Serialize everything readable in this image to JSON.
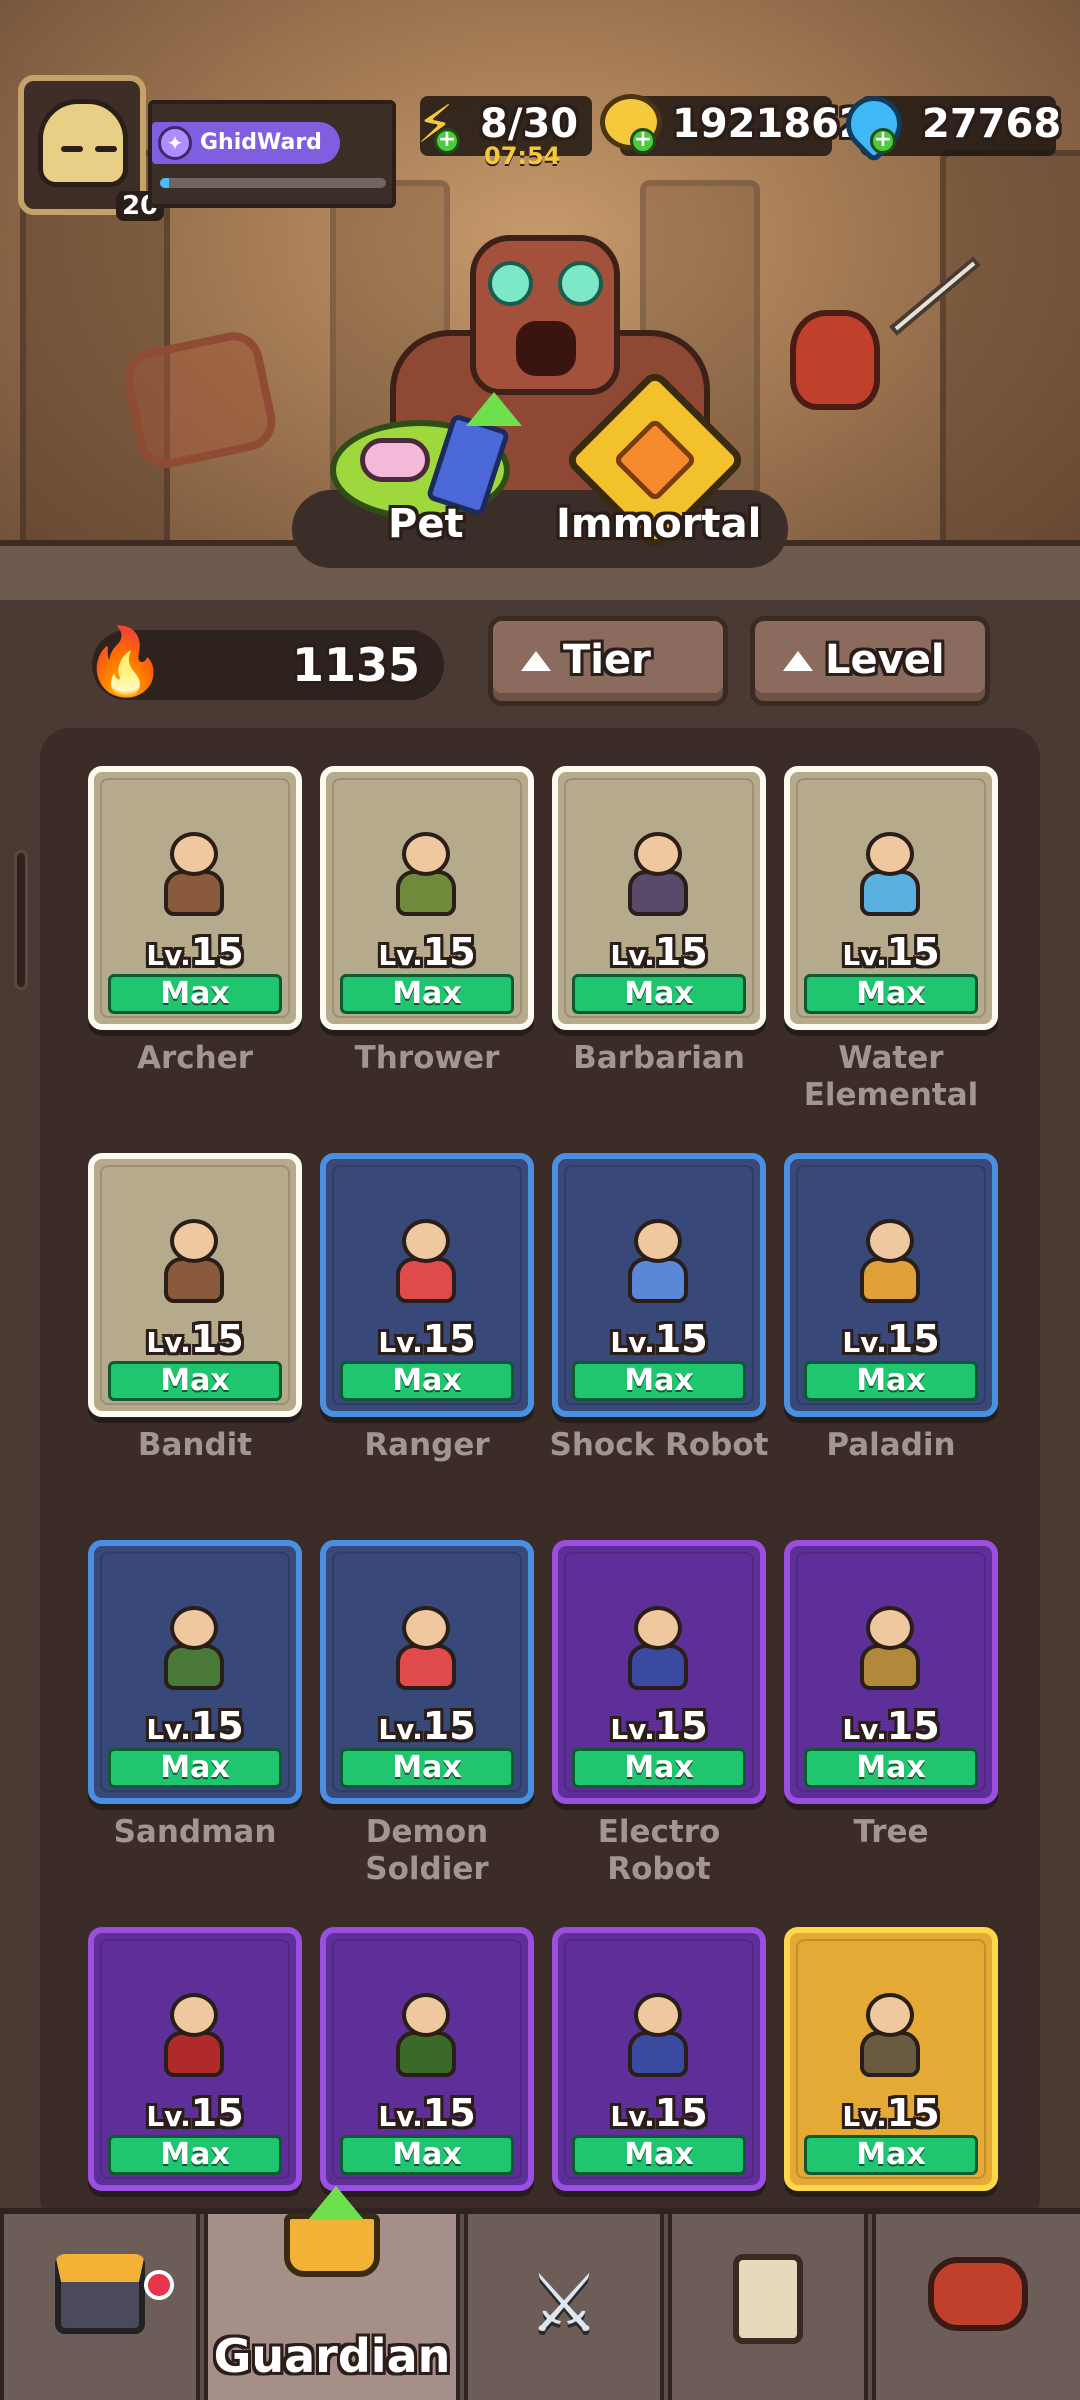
{
  "player": {
    "name": "GhidWard",
    "level": "20",
    "xp_progress": 0.04
  },
  "resources": {
    "energy": "8/30",
    "energy_timer": "07:54",
    "gold": "1921862",
    "gems": "27768"
  },
  "mode_switch": {
    "pet_label": "Pet",
    "immortal_label": "Immortal"
  },
  "filter_bar": {
    "power": "1135",
    "tier_label": "Tier",
    "level_label": "Level"
  },
  "cards": [
    {
      "name": "Archer",
      "lv_prefix": "Lv.",
      "lv": "15",
      "status": "Max",
      "rarity": "common"
    },
    {
      "name": "Thrower",
      "lv_prefix": "Lv.",
      "lv": "15",
      "status": "Max",
      "rarity": "common"
    },
    {
      "name": "Barbarian",
      "lv_prefix": "Lv.",
      "lv": "15",
      "status": "Max",
      "rarity": "common"
    },
    {
      "name": "Water Elemental",
      "lv_prefix": "Lv.",
      "lv": "15",
      "status": "Max",
      "rarity": "common"
    },
    {
      "name": "Bandit",
      "lv_prefix": "Lv.",
      "lv": "15",
      "status": "Max",
      "rarity": "common"
    },
    {
      "name": "Ranger",
      "lv_prefix": "Lv.",
      "lv": "15",
      "status": "Max",
      "rarity": "rare"
    },
    {
      "name": "Shock Robot",
      "lv_prefix": "Lv.",
      "lv": "15",
      "status": "Max",
      "rarity": "rare"
    },
    {
      "name": "Paladin",
      "lv_prefix": "Lv.",
      "lv": "15",
      "status": "Max",
      "rarity": "rare"
    },
    {
      "name": "Sandman",
      "lv_prefix": "Lv.",
      "lv": "15",
      "status": "Max",
      "rarity": "rare"
    },
    {
      "name": "Demon Soldier",
      "lv_prefix": "Lv.",
      "lv": "15",
      "status": "Max",
      "rarity": "rare"
    },
    {
      "name": "Electro Robot",
      "lv_prefix": "Lv.",
      "lv": "15",
      "status": "Max",
      "rarity": "epic"
    },
    {
      "name": "Tree",
      "lv_prefix": "Lv.",
      "lv": "15",
      "status": "Max",
      "rarity": "epic"
    },
    {
      "name": "",
      "lv_prefix": "Lv.",
      "lv": "15",
      "status": "Max",
      "rarity": "epic"
    },
    {
      "name": "",
      "lv_prefix": "Lv.",
      "lv": "15",
      "status": "Max",
      "rarity": "epic"
    },
    {
      "name": "",
      "lv_prefix": "Lv.",
      "lv": "15",
      "status": "Max",
      "rarity": "epic"
    },
    {
      "name": "",
      "lv_prefix": "Lv.",
      "lv": "15",
      "status": "Max",
      "rarity": "legend"
    }
  ],
  "bottom_nav": {
    "shop_icon": "shop-stall-icon",
    "guardian_label": "Guardian",
    "battle_icon": "crossed-swords-icon",
    "cards_icon": "crown-card-icon",
    "guild_icon": "guild-members-icon"
  },
  "colors": {
    "common": "#b6aa8c",
    "rare": "#374879",
    "epic": "#5f2f99",
    "legend": "#e5a935",
    "max_green": "#1fc56f"
  }
}
